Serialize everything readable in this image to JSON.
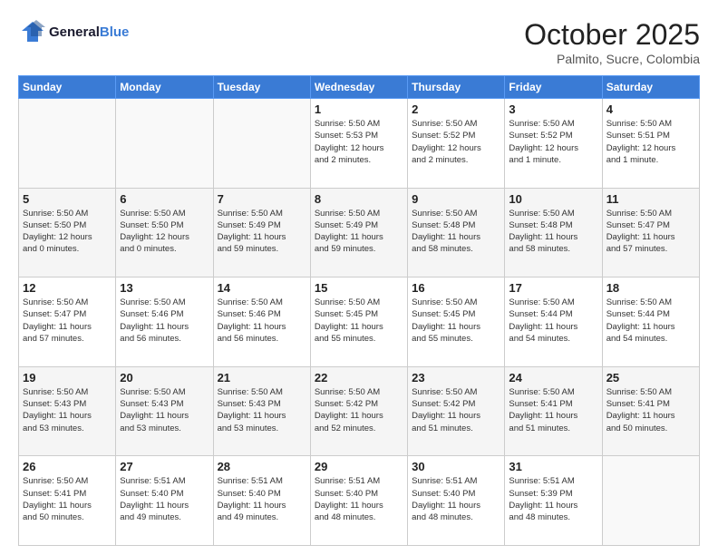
{
  "header": {
    "logo_line1": "General",
    "logo_line2": "Blue",
    "month": "October 2025",
    "location": "Palmito, Sucre, Colombia"
  },
  "weekdays": [
    "Sunday",
    "Monday",
    "Tuesday",
    "Wednesday",
    "Thursday",
    "Friday",
    "Saturday"
  ],
  "weeks": [
    [
      {
        "day": "",
        "info": ""
      },
      {
        "day": "",
        "info": ""
      },
      {
        "day": "",
        "info": ""
      },
      {
        "day": "1",
        "info": "Sunrise: 5:50 AM\nSunset: 5:53 PM\nDaylight: 12 hours\nand 2 minutes."
      },
      {
        "day": "2",
        "info": "Sunrise: 5:50 AM\nSunset: 5:52 PM\nDaylight: 12 hours\nand 2 minutes."
      },
      {
        "day": "3",
        "info": "Sunrise: 5:50 AM\nSunset: 5:52 PM\nDaylight: 12 hours\nand 1 minute."
      },
      {
        "day": "4",
        "info": "Sunrise: 5:50 AM\nSunset: 5:51 PM\nDaylight: 12 hours\nand 1 minute."
      }
    ],
    [
      {
        "day": "5",
        "info": "Sunrise: 5:50 AM\nSunset: 5:50 PM\nDaylight: 12 hours\nand 0 minutes."
      },
      {
        "day": "6",
        "info": "Sunrise: 5:50 AM\nSunset: 5:50 PM\nDaylight: 12 hours\nand 0 minutes."
      },
      {
        "day": "7",
        "info": "Sunrise: 5:50 AM\nSunset: 5:49 PM\nDaylight: 11 hours\nand 59 minutes."
      },
      {
        "day": "8",
        "info": "Sunrise: 5:50 AM\nSunset: 5:49 PM\nDaylight: 11 hours\nand 59 minutes."
      },
      {
        "day": "9",
        "info": "Sunrise: 5:50 AM\nSunset: 5:48 PM\nDaylight: 11 hours\nand 58 minutes."
      },
      {
        "day": "10",
        "info": "Sunrise: 5:50 AM\nSunset: 5:48 PM\nDaylight: 11 hours\nand 58 minutes."
      },
      {
        "day": "11",
        "info": "Sunrise: 5:50 AM\nSunset: 5:47 PM\nDaylight: 11 hours\nand 57 minutes."
      }
    ],
    [
      {
        "day": "12",
        "info": "Sunrise: 5:50 AM\nSunset: 5:47 PM\nDaylight: 11 hours\nand 57 minutes."
      },
      {
        "day": "13",
        "info": "Sunrise: 5:50 AM\nSunset: 5:46 PM\nDaylight: 11 hours\nand 56 minutes."
      },
      {
        "day": "14",
        "info": "Sunrise: 5:50 AM\nSunset: 5:46 PM\nDaylight: 11 hours\nand 56 minutes."
      },
      {
        "day": "15",
        "info": "Sunrise: 5:50 AM\nSunset: 5:45 PM\nDaylight: 11 hours\nand 55 minutes."
      },
      {
        "day": "16",
        "info": "Sunrise: 5:50 AM\nSunset: 5:45 PM\nDaylight: 11 hours\nand 55 minutes."
      },
      {
        "day": "17",
        "info": "Sunrise: 5:50 AM\nSunset: 5:44 PM\nDaylight: 11 hours\nand 54 minutes."
      },
      {
        "day": "18",
        "info": "Sunrise: 5:50 AM\nSunset: 5:44 PM\nDaylight: 11 hours\nand 54 minutes."
      }
    ],
    [
      {
        "day": "19",
        "info": "Sunrise: 5:50 AM\nSunset: 5:43 PM\nDaylight: 11 hours\nand 53 minutes."
      },
      {
        "day": "20",
        "info": "Sunrise: 5:50 AM\nSunset: 5:43 PM\nDaylight: 11 hours\nand 53 minutes."
      },
      {
        "day": "21",
        "info": "Sunrise: 5:50 AM\nSunset: 5:43 PM\nDaylight: 11 hours\nand 53 minutes."
      },
      {
        "day": "22",
        "info": "Sunrise: 5:50 AM\nSunset: 5:42 PM\nDaylight: 11 hours\nand 52 minutes."
      },
      {
        "day": "23",
        "info": "Sunrise: 5:50 AM\nSunset: 5:42 PM\nDaylight: 11 hours\nand 51 minutes."
      },
      {
        "day": "24",
        "info": "Sunrise: 5:50 AM\nSunset: 5:41 PM\nDaylight: 11 hours\nand 51 minutes."
      },
      {
        "day": "25",
        "info": "Sunrise: 5:50 AM\nSunset: 5:41 PM\nDaylight: 11 hours\nand 50 minutes."
      }
    ],
    [
      {
        "day": "26",
        "info": "Sunrise: 5:50 AM\nSunset: 5:41 PM\nDaylight: 11 hours\nand 50 minutes."
      },
      {
        "day": "27",
        "info": "Sunrise: 5:51 AM\nSunset: 5:40 PM\nDaylight: 11 hours\nand 49 minutes."
      },
      {
        "day": "28",
        "info": "Sunrise: 5:51 AM\nSunset: 5:40 PM\nDaylight: 11 hours\nand 49 minutes."
      },
      {
        "day": "29",
        "info": "Sunrise: 5:51 AM\nSunset: 5:40 PM\nDaylight: 11 hours\nand 48 minutes."
      },
      {
        "day": "30",
        "info": "Sunrise: 5:51 AM\nSunset: 5:40 PM\nDaylight: 11 hours\nand 48 minutes."
      },
      {
        "day": "31",
        "info": "Sunrise: 5:51 AM\nSunset: 5:39 PM\nDaylight: 11 hours\nand 48 minutes."
      },
      {
        "day": "",
        "info": ""
      }
    ]
  ]
}
